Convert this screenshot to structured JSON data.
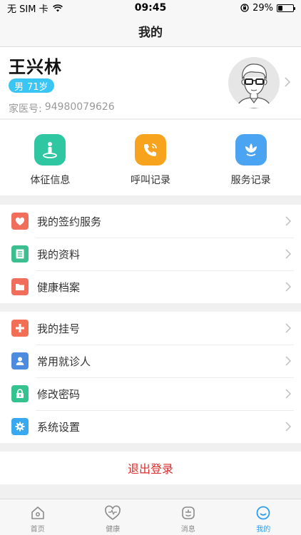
{
  "status_bar": {
    "carrier": "无 SIM 卡",
    "time": "09:45",
    "battery_percent": "29%",
    "battery_level": 0.29
  },
  "nav": {
    "title": "我的"
  },
  "profile": {
    "name": "王兴林",
    "gender": "男",
    "age": "71岁",
    "doctor_label": "家医号:",
    "doctor_number": "94980079626"
  },
  "quick_actions": [
    {
      "label": "体征信息",
      "icon": "person-pin-icon",
      "color": "#2fc7a2"
    },
    {
      "label": "呼叫记录",
      "icon": "phone-ring-icon",
      "color": "#f7a31e"
    },
    {
      "label": "服务记录",
      "icon": "lotus-icon",
      "color": "#4aa4f2"
    }
  ],
  "group1": [
    {
      "label": "我的签约服务",
      "icon": "heart-icon",
      "color": "#f06e5b"
    },
    {
      "label": "我的资料",
      "icon": "document-icon",
      "color": "#3bbf8e"
    },
    {
      "label": "健康档案",
      "icon": "folder-icon",
      "color": "#f06e5b"
    }
  ],
  "group2": [
    {
      "label": "我的挂号",
      "icon": "plus-icon",
      "color": "#f26f56"
    },
    {
      "label": "常用就诊人",
      "icon": "user-icon",
      "color": "#4d8be0"
    },
    {
      "label": "修改密码",
      "icon": "lock-icon",
      "color": "#34c28e"
    },
    {
      "label": "系统设置",
      "icon": "gear-icon",
      "color": "#38a9f0"
    }
  ],
  "logout": {
    "label": "退出登录",
    "color": "#d92b2b"
  },
  "tabs": [
    {
      "label": "首页",
      "icon": "home-icon",
      "active": false
    },
    {
      "label": "健康",
      "icon": "heart-outline-icon",
      "active": false
    },
    {
      "label": "消息",
      "icon": "message-icon",
      "active": false
    },
    {
      "label": "我的",
      "icon": "smile-icon",
      "active": true
    }
  ],
  "accent_color": "#2a9df4"
}
